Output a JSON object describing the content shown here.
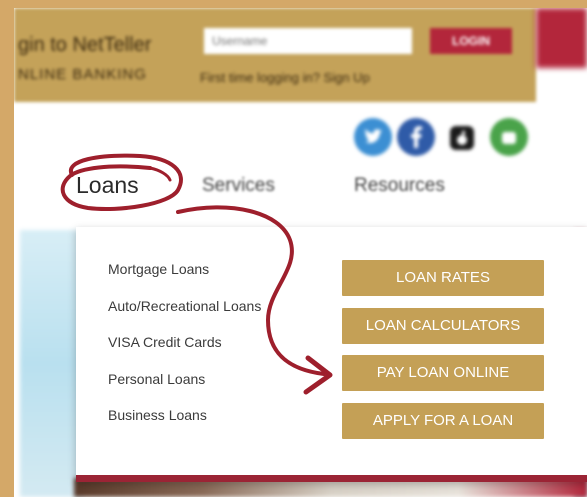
{
  "login": {
    "title": "gin to NetTeller",
    "subtitle": "NLINE BANKING",
    "username_placeholder": "Username",
    "login_button": "LOGIN",
    "first_time_text": "First time logging in? Sign Up"
  },
  "social": {
    "icons": [
      "twitter-icon",
      "facebook-icon",
      "apple-icon",
      "android-icon"
    ]
  },
  "nav": {
    "loans": "Loans",
    "services": "Services",
    "resources": "Resources"
  },
  "dropdown": {
    "items": [
      "Mortgage Loans",
      "Auto/Recreational Loans",
      "VISA Credit Cards",
      "Personal Loans",
      "Business Loans"
    ],
    "buttons": [
      "LOAN RATES",
      "LOAN CALCULATORS",
      "PAY LOAN ONLINE",
      "APPLY FOR A LOAN"
    ]
  },
  "colors": {
    "gold": "#c4a056",
    "red": "#9b2435",
    "annotation": "#9e1f2c"
  }
}
